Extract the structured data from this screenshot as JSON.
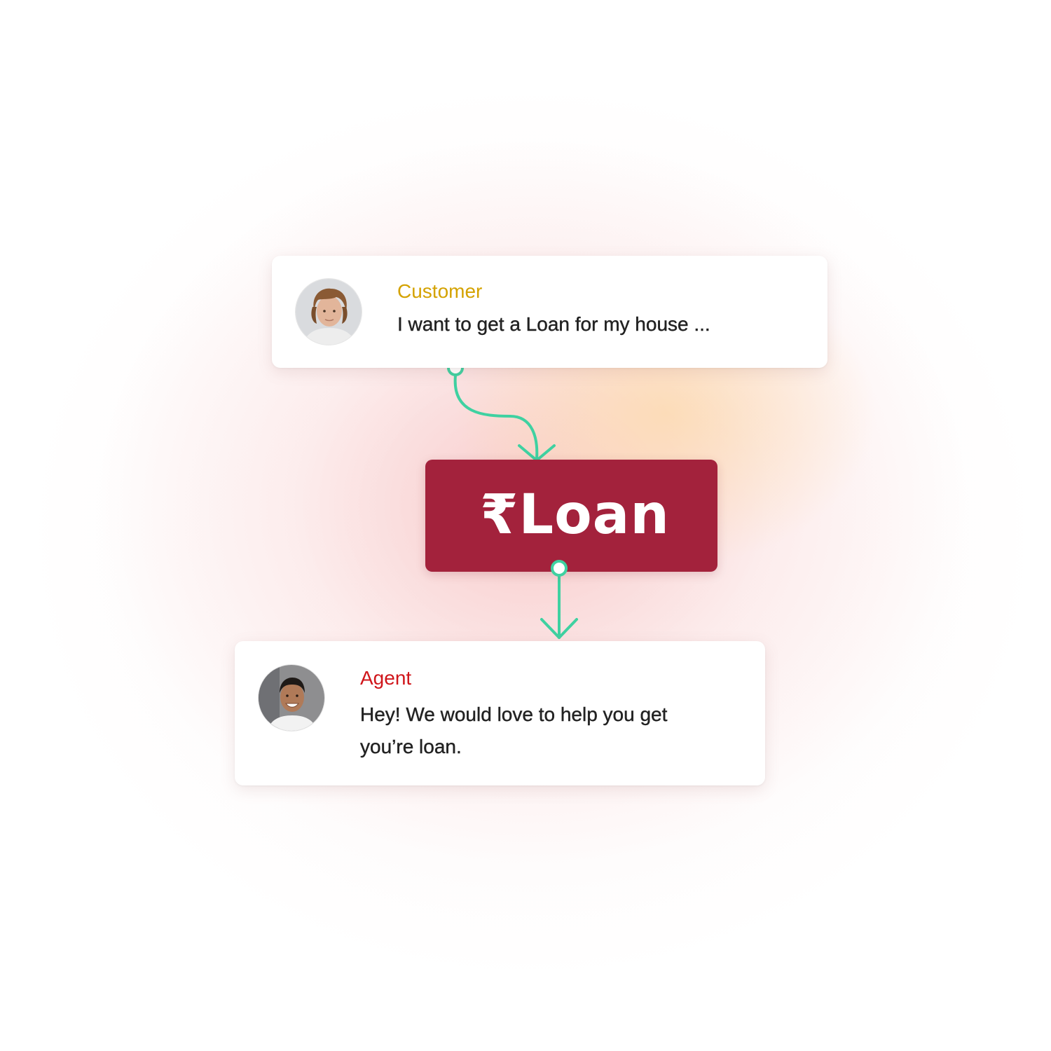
{
  "colors": {
    "customer_role": "#D4A200",
    "agent_role": "#D0161B",
    "loan_box": "#A3223C",
    "connector": "#3FD1A1"
  },
  "customer": {
    "role": "Customer",
    "message": "I want to get a Loan for my house ...",
    "avatar_icon": "person-avatar-icon"
  },
  "loan": {
    "label": "₹Loan"
  },
  "agent": {
    "role": "Agent",
    "message": "Hey! We would love to help you get you’re loan.",
    "avatar_icon": "person-avatar-icon"
  }
}
